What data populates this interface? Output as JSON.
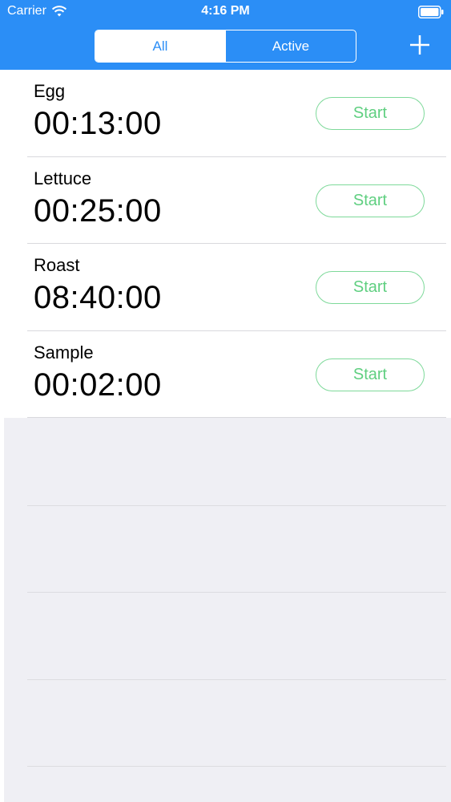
{
  "status_bar": {
    "carrier": "Carrier",
    "time": "4:16 PM",
    "icons": [
      "wifi-icon",
      "battery-icon"
    ]
  },
  "nav": {
    "segments": [
      {
        "label": "All",
        "selected": true
      },
      {
        "label": "Active",
        "selected": false
      }
    ],
    "add_icon": "plus-icon"
  },
  "timers": [
    {
      "name": "Egg",
      "time": "00:13:00",
      "button": "Start"
    },
    {
      "name": "Lettuce",
      "time": "00:25:00",
      "button": "Start"
    },
    {
      "name": "Roast",
      "time": "08:40:00",
      "button": "Start"
    },
    {
      "name": "Sample",
      "time": "00:02:00",
      "button": "Start"
    }
  ],
  "colors": {
    "nav_blue": "#2b8ef6",
    "start_green": "#5fcf80",
    "background_gray": "#efeff4"
  }
}
